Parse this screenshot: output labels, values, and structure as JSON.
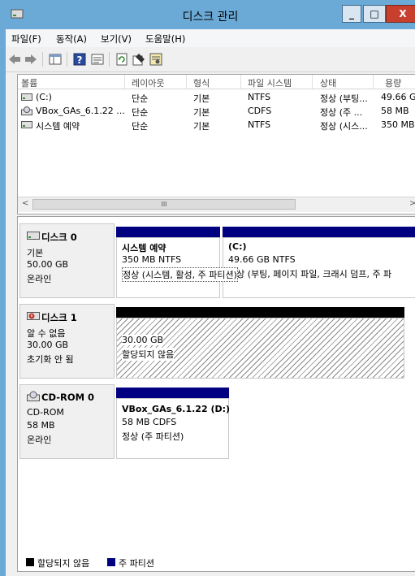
{
  "window": {
    "title": "디스크 관리",
    "min": "_",
    "max": "□",
    "close": "X",
    "accent": "#6ba9d6"
  },
  "menu": [
    "파일(F)",
    "동작(A)",
    "보기(V)",
    "도움말(H)"
  ],
  "toolbar_icons": [
    "back-arrow-icon",
    "forward-arrow-icon",
    "console-tree-icon",
    "help-icon",
    "properties-list-icon",
    "refresh-icon",
    "properties-icon",
    "disk-settings-icon"
  ],
  "volumes": {
    "headers": [
      "볼륨",
      "레이아웃",
      "형식",
      "파일 시스템",
      "상태",
      "용량"
    ],
    "rows": [
      {
        "name": "(C:)",
        "layout": "단순",
        "type": "기본",
        "fs": "NTFS",
        "status": "정상 (부팅...",
        "capacity": "49.66 GB"
      },
      {
        "name": "VBox_GAs_6.1.22 ...",
        "layout": "단순",
        "type": "기본",
        "fs": "CDFS",
        "status": "정상 (주 ...",
        "capacity": "58 MB"
      },
      {
        "name": "시스템 예약",
        "layout": "단순",
        "type": "기본",
        "fs": "NTFS",
        "status": "정상 (시스...",
        "capacity": "350 MB"
      }
    ],
    "scroll_thumb": "III"
  },
  "disks": [
    {
      "name": "디스크 0",
      "lines": [
        "기본",
        "50.00 GB",
        "온라인"
      ],
      "partitions": [
        {
          "title": "시스템 예약",
          "size": "350 MB NTFS",
          "status": "정상 (시스템, 활성, 주 파티션)"
        },
        {
          "title": "(C:)",
          "size": "49.66 GB NTFS",
          "status": "정상 (부팅, 페이지 파일, 크래시 덤프, 주 파"
        }
      ]
    },
    {
      "name": "디스크 1",
      "lines": [
        "알 수 없음",
        "30.00 GB",
        "초기화 안 됨"
      ],
      "partitions": [
        {
          "size": "30.00 GB",
          "status": "할당되지 않음"
        }
      ]
    },
    {
      "name": "CD-ROM 0",
      "lines": [
        "CD-ROM",
        "58 MB",
        "온라인"
      ],
      "partitions": [
        {
          "title": "VBox_GAs_6.1.22  (D:)",
          "size": "58 MB CDFS",
          "status": "정상 (주 파티션)"
        }
      ]
    }
  ],
  "legend": [
    {
      "label": "할당되지 않음",
      "color": "#000000"
    },
    {
      "label": "주 파티션",
      "color": "#000080"
    }
  ]
}
